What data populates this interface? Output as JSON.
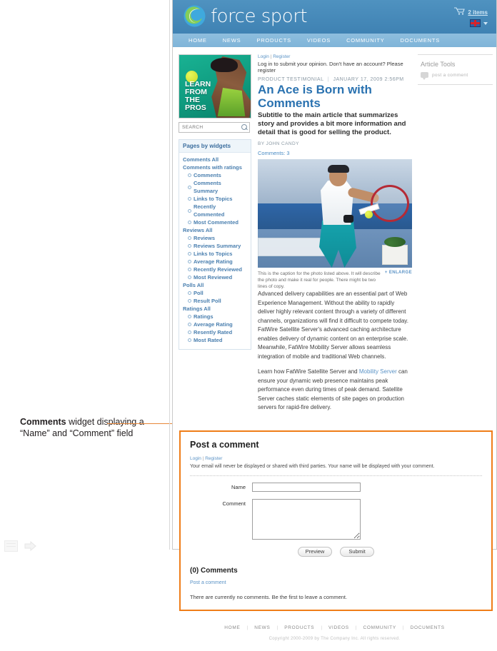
{
  "annotation": {
    "strong": "Comments",
    "rest": " widget displaying a “Name” and “Comment” field"
  },
  "header": {
    "logo_text": "force sport",
    "cart_label": "2 items",
    "cart_icon": "shopping-cart-icon",
    "flag_icon": "flag-icon",
    "caret_icon": "chevron-down-icon"
  },
  "nav": {
    "items": [
      {
        "label": "HOME"
      },
      {
        "label": "NEWS"
      },
      {
        "label": "PRODUCTS"
      },
      {
        "label": "VIDEOS"
      },
      {
        "label": "COMMUNITY"
      },
      {
        "label": "DOCUMENTS"
      }
    ]
  },
  "sidebar": {
    "promo": {
      "line1": "LEARN",
      "line2": "FROM",
      "line3": "THE",
      "line4": "PROS"
    },
    "search": {
      "placeholder": "SEARCH",
      "value": "",
      "icon": "magnifier-icon"
    },
    "widgets_title": "Pages by widgets",
    "groups": [
      {
        "label": "Comments All",
        "children": []
      },
      {
        "label": "Comments with ratings",
        "children": [
          {
            "label": "Comments"
          },
          {
            "label": "Comments Summary"
          },
          {
            "label": "Links to Topics"
          },
          {
            "label": "Recently Commented"
          },
          {
            "label": "Most Commented"
          }
        ]
      },
      {
        "label": "Reviews All",
        "children": [
          {
            "label": "Reviews"
          },
          {
            "label": "Reviews Summary"
          },
          {
            "label": "Links to Topics"
          },
          {
            "label": "Average Rating"
          },
          {
            "label": "Recently Reviewed"
          },
          {
            "label": "Most Reviewed"
          }
        ]
      },
      {
        "label": "Polls All",
        "children": [
          {
            "label": "Poll"
          },
          {
            "label": "Result Poll"
          }
        ]
      },
      {
        "label": "Ratings All",
        "children": [
          {
            "label": "Ratings"
          },
          {
            "label": "Average Rating"
          },
          {
            "label": "Resently Rated"
          },
          {
            "label": "Most Rated"
          }
        ]
      }
    ]
  },
  "article": {
    "login_label": "Login",
    "register_label": "Register",
    "login_note": "Log in to submit your opinion. Don't have an account? Please register",
    "kicker": "PRODUCT TESTIMONIAL",
    "date": "JANUARY 17, 2009 2:56PM",
    "headline": "An Ace is Born with Comments",
    "subtitle": "Subtitle to the main article that summarizes story and provides a bit more information and detail that is good for selling the product.",
    "byline": "BY JOHN CANDY",
    "comments_count": "Comments: 3",
    "hero_alt": "tennis-player-photo",
    "caption": "This is the caption for the photo listed above. It will describe the photo and make it real for people. There might be two lines of copy.",
    "enlarge_label": "+ ENLARGE",
    "paragraph1": "Advanced delivery capabilities are an essential part of Web Experience Management. Without the ability to rapidly deliver highly relevant content through a variety of different channels, organizations will find it difficult to compete today. FatWire Satellite Server's advanced caching architecture enables delivery of dynamic content on an enterprise scale. Meanwhile, FatWire Mobility Server allows seamless integration of mobile and traditional Web channels.",
    "paragraph2_before": "Learn how FatWire Satellite Server and ",
    "paragraph2_link": "Mobility Server",
    "paragraph2_after": " can ensure your dynamic web presence maintains peak performance even during times of peak demand. Satellite Server caches static elements of site pages on production servers for rapid-fire delivery."
  },
  "tools": {
    "title": "Article Tools",
    "post_comment": "post a comment",
    "icon": "speech-bubble-icon"
  },
  "comment_widget": {
    "title": "Post a comment",
    "login_label": "Login",
    "register_label": "Register",
    "privacy_note": "Your email will never be displayed or shared with third parties. Your name will be displayed with your comment.",
    "name_label": "Name",
    "name_value": "",
    "comment_label": "Comment",
    "comment_value": "",
    "preview_button": "Preview",
    "submit_button": "Submit",
    "count_heading": "(0) Comments",
    "post_link": "Post a comment",
    "empty_message": "There are currently no comments. Be the first to leave a comment.",
    "highlight_color": "#ef7d18"
  },
  "footer": {
    "items": [
      {
        "label": "HOME"
      },
      {
        "label": "NEWS"
      },
      {
        "label": "PRODUCTS"
      },
      {
        "label": "VIDEOS"
      },
      {
        "label": "COMMUNITY"
      },
      {
        "label": "DOCUMENTS"
      }
    ],
    "copyright": "Copyright 2000-2009 by The Company Inc. All rights reserved."
  }
}
